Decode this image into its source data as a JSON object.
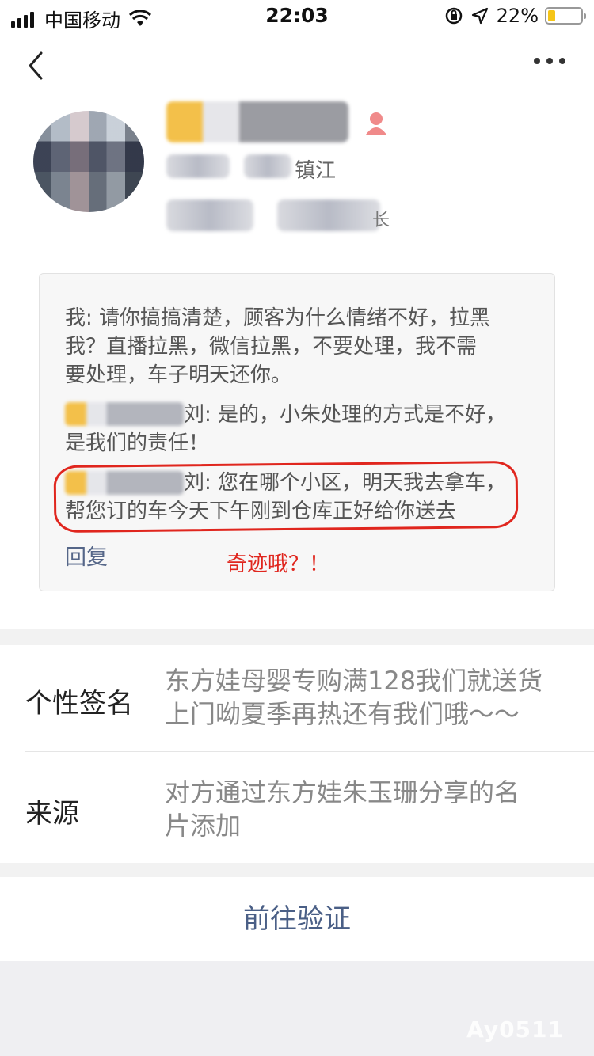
{
  "status_bar": {
    "carrier": "中国移动",
    "time": "22:03",
    "battery_percent": "22%",
    "battery_level": 0.22
  },
  "profile": {
    "city_fragment": "镇江",
    "line3_fragment": "长"
  },
  "comment": {
    "me_line": "我: 请你搞搞清楚，顾客为什么情绪不好，拉黑我？直播拉黑，微信拉黑，不要处理，我不需要处理，车子明天还你。",
    "me_lines": [
      "我: 请你搞搞清楚，顾客为什么情绪不好，拉黑",
      "我？直播拉黑，微信拉黑，不要处理，我不需",
      "要处理，车子明天还你。"
    ],
    "reply1_lines": [
      "刘: 是的，小朱处理的方式是不好，",
      "是我们的责任！"
    ],
    "reply2_lines": [
      "刘: 您在哪个小区，明天我去拿车，",
      "帮您订的车今天下午刚到仓库正好给你送去"
    ],
    "reply_link": "回复",
    "annotation": "奇迹哦？！"
  },
  "info": {
    "signature_label": "个性签名",
    "signature_lines": [
      "东方娃母婴专购满128我们就送货",
      "上门呦夏季再热还有我们哦～～"
    ],
    "source_label": "来源",
    "source_lines": [
      "对方通过东方娃朱玉珊分享的名",
      "片添加"
    ]
  },
  "verify_button": "前往验证",
  "watermark": "Ay0511",
  "colors": {
    "accent_link": "#556688",
    "button_text": "#4a5f86",
    "annotation_red": "#e0261e",
    "battery_fill": "#f5c518"
  },
  "icons": [
    "signal-icon",
    "wifi-icon",
    "orientation-lock-icon",
    "location-arrow-icon",
    "battery-icon",
    "back-chevron-icon",
    "more-icon",
    "female-icon"
  ]
}
